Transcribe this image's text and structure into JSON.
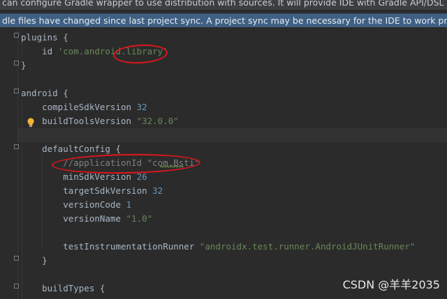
{
  "banners": {
    "wrapper_tip": "can configure Gradle wrapper to use distribution with sources. It will provide IDE with Gradle API/DSL doc...",
    "sync_notice": "dle files have changed since last project sync. A project sync may be necessary for the IDE to work properly."
  },
  "code": [
    "plugins {",
    "    id 'com.android.library'",
    "}",
    "",
    "android {",
    "    compileSdkVersion 32",
    "    buildToolsVersion \"32.0.0\"",
    "",
    "    defaultConfig {",
    "        //applicationId \"com.Bsti\"",
    "        minSdkVersion 26",
    "        targetSdkVersion 32",
    "        versionCode 1",
    "        versionName \"1.0\"",
    "",
    "        testInstrumentationRunner \"androidx.test.runner.AndroidJUnitRunner\"",
    "    }",
    "",
    "    buildTypes {"
  ],
  "tokens": {
    "plugins_open": "plugins {",
    "id_kw": "    id ",
    "plugin_id": "'com.android.library'",
    "close_brace": "}",
    "android_open": "android {",
    "compile_kw": "    compileSdkVersion ",
    "compile_val": "32",
    "buildtools_kw": "    buildToolsVersion ",
    "buildtools_val": "\"32.0.0\"",
    "defaultconfig_open": "    defaultConfig {",
    "application_id_comment": "        //applicationId \"com.Bsti\"",
    "minsdk_kw": "        minSdkVersion ",
    "minsdk_val": "26",
    "targetsdk_kw": "        targetSdkVersion ",
    "targetsdk_val": "32",
    "versioncode_kw": "        versionCode ",
    "versioncode_val": "1",
    "versionname_kw": "        versionName ",
    "versionname_val": "\"1.0\"",
    "runner_kw": "        testInstrumentationRunner ",
    "runner_val": "\"androidx.test.runner.AndroidJUnitRunner\"",
    "inner_close": "    }",
    "buildtypes_open": "    buildTypes {"
  },
  "watermark": "CSDN @羊羊2035",
  "icons": {
    "intention": "lightbulb-icon",
    "fold": "fold-marker-icon"
  },
  "colors": {
    "editor_bg": "#2b2b2b",
    "text": "#a9b7c6",
    "number": "#6897bb",
    "string": "#6a8759",
    "comment": "#808080",
    "banner_sync": "#3f5f83",
    "annotation": "#e0161c"
  }
}
